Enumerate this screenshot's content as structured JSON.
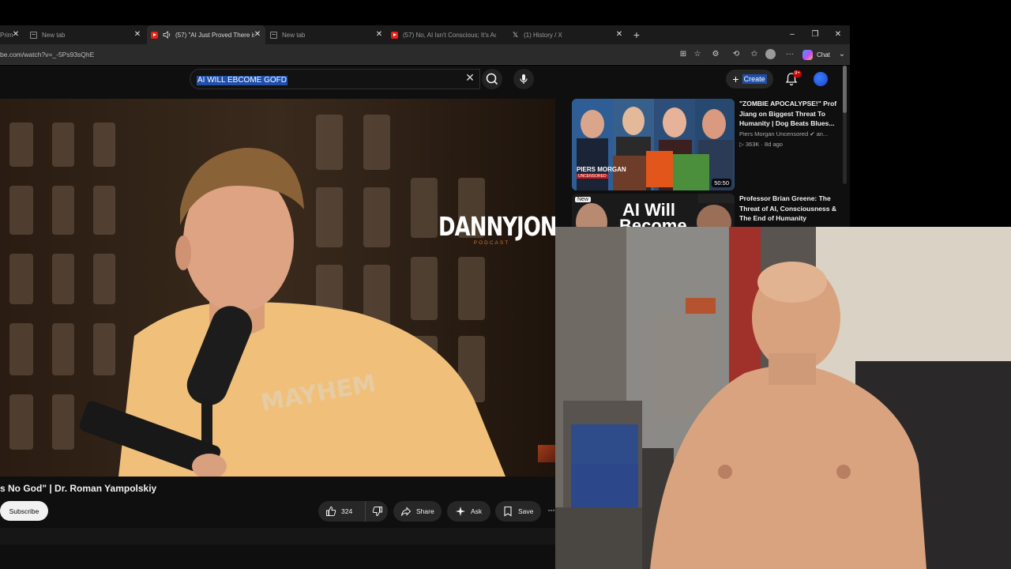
{
  "browser": {
    "tabs": [
      {
        "title": "Prim",
        "icon": "page-icon",
        "active": false
      },
      {
        "title": "New tab",
        "icon": "page-icon",
        "active": false
      },
      {
        "title": "(57) \"AI Just Proved There is N",
        "icon": "youtube-icon",
        "active": true
      },
      {
        "title": "New tab",
        "icon": "page-icon",
        "active": false
      },
      {
        "title": "(57) No, AI Isn't Conscious; It's Ac",
        "icon": "youtube-icon",
        "active": false
      },
      {
        "title": "(1) History / X",
        "icon": "x-icon",
        "active": false
      }
    ],
    "tab_close_glyph": "✕",
    "new_tab_glyph": "+",
    "url": "be.com/watch?v=_-5Ps93sQhE",
    "chat_label": "Chat",
    "window_controls": {
      "minimize": "–",
      "maximize": "❐",
      "close": "✕"
    }
  },
  "youtube": {
    "search_query": "AI WILL EBCOME GOFD",
    "create_label": "Create",
    "notification_badge": "9+",
    "video": {
      "title": "s No God\" | Dr. Roman Yampolskiy",
      "subscribe_label": "Subscribe",
      "like_count": "324",
      "share_label": "Share",
      "ask_label": "Ask",
      "save_label": "Save",
      "more_glyph": "···",
      "logo_main": "DANNYJONES",
      "logo_sub": "PODCAST"
    },
    "recommendations": [
      {
        "title": "\"ZOMBIE APOCALYPSE!\" Prof Jiang on Biggest Threat To Humanity | Dog Beats Blues...",
        "channel": "Piers Morgan Uncensored ✔ an...",
        "meta": "▷ 363K · 8d ago",
        "duration": "50:50",
        "thumb_text": "PIERS MORGAN",
        "thumb_sub": "UNCENSORED"
      },
      {
        "title": "Professor Brian Greene: The Threat of AI, Consciousness & The End of Humanity",
        "badge": "New",
        "thumb_text": "AI Will",
        "thumb_text2": "Become"
      }
    ]
  },
  "colors": {
    "yt_bg": "#0f0f0f",
    "selection": "#1f4fa8",
    "accent_red": "#cc0000",
    "logo_orange": "#c9762f"
  }
}
